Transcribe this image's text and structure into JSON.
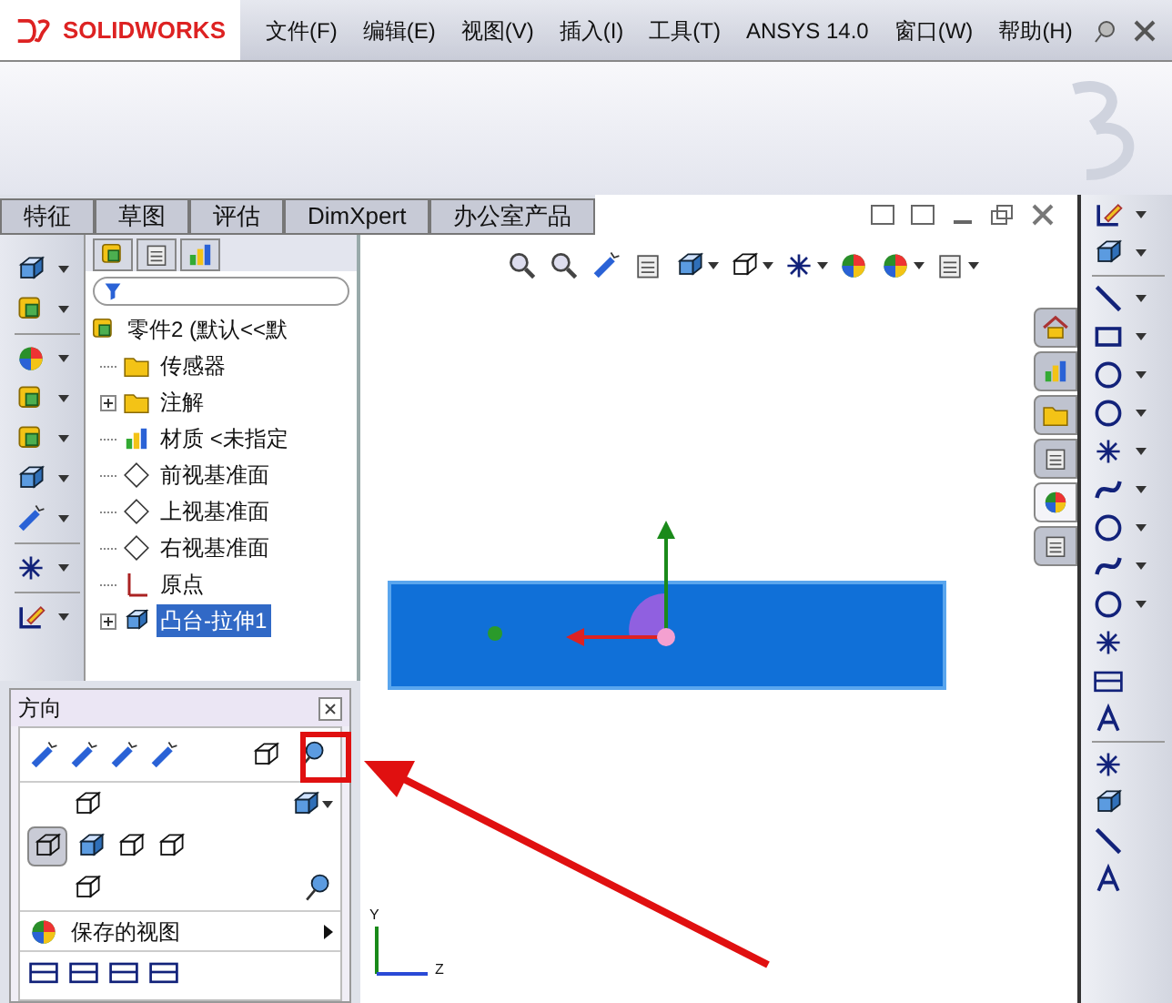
{
  "app_logo": {
    "text": "SOLIDWORKS"
  },
  "menu": [
    "文件(F)",
    "编辑(E)",
    "视图(V)",
    "插入(I)",
    "工具(T)",
    "ANSYS 14.0",
    "窗口(W)",
    "帮助(H)"
  ],
  "tabs": [
    {
      "label": "特征",
      "selected": false
    },
    {
      "label": "草图",
      "selected": false
    },
    {
      "label": "评估",
      "selected": false
    },
    {
      "label": "DimXpert",
      "selected": false
    },
    {
      "label": "办公室产品",
      "selected": false
    }
  ],
  "feature_tree": {
    "items": [
      {
        "kind": "part",
        "label": "零件2 (默认<<默",
        "selected": false,
        "expandable": false
      },
      {
        "kind": "sensor",
        "label": "传感器",
        "selected": false,
        "expandable": false
      },
      {
        "kind": "annotation",
        "label": "注解",
        "selected": false,
        "expandable": true
      },
      {
        "kind": "material",
        "label": "材质 <未指定",
        "selected": false,
        "expandable": false
      },
      {
        "kind": "plane",
        "label": "前视基准面",
        "selected": false,
        "expandable": false
      },
      {
        "kind": "plane",
        "label": "上视基准面",
        "selected": false,
        "expandable": false
      },
      {
        "kind": "plane",
        "label": "右视基准面",
        "selected": false,
        "expandable": false
      },
      {
        "kind": "origin",
        "label": "原点",
        "selected": false,
        "expandable": false
      },
      {
        "kind": "feature",
        "label": "凸台-拉伸1",
        "selected": true,
        "expandable": true
      }
    ]
  },
  "orientation_panel": {
    "title": "方向",
    "saved_views": "保存的视图"
  },
  "task_pane_tabs": [
    {
      "selected": false
    },
    {
      "selected": false
    },
    {
      "selected": false
    },
    {
      "selected": false
    },
    {
      "selected": true
    },
    {
      "selected": false
    }
  ],
  "triad": {
    "y_label": "Y",
    "z_label": "Z"
  }
}
